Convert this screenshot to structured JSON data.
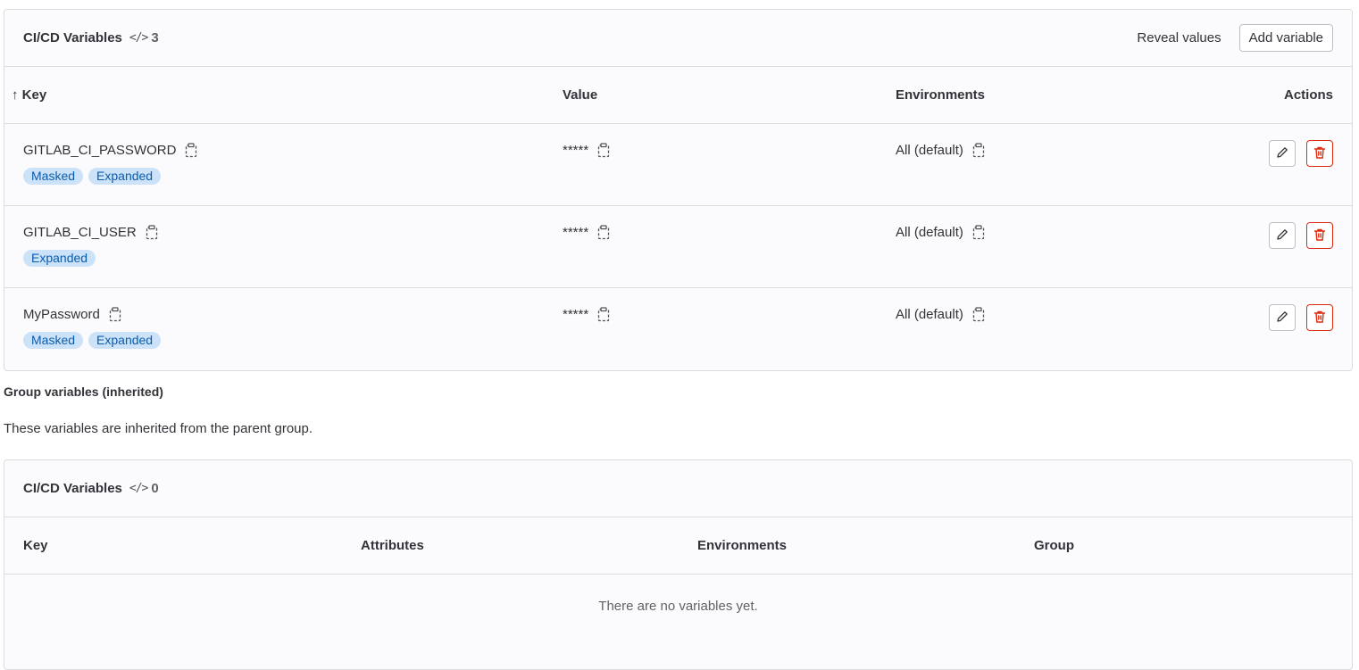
{
  "project_variables": {
    "title": "CI/CD Variables",
    "count": "3",
    "code_symbol": "</>",
    "reveal_label": "Reveal values",
    "add_label": "Add variable",
    "columns": {
      "key": "↑ Key",
      "value": "Value",
      "environments": "Environments",
      "actions": "Actions"
    },
    "rows": [
      {
        "key": "GITLAB_CI_PASSWORD",
        "value": "*****",
        "env": "All (default)",
        "badges": [
          "Masked",
          "Expanded"
        ]
      },
      {
        "key": "GITLAB_CI_USER",
        "value": "*****",
        "env": "All (default)",
        "badges": [
          "Expanded"
        ]
      },
      {
        "key": "MyPassword",
        "value": "*****",
        "env": "All (default)",
        "badges": [
          "Masked",
          "Expanded"
        ]
      }
    ]
  },
  "group_section": {
    "title": "Group variables (inherited)",
    "description": "These variables are inherited from the parent group."
  },
  "group_variables": {
    "title": "CI/CD Variables",
    "count": "0",
    "code_symbol": "</>",
    "columns": {
      "key": "Key",
      "attributes": "Attributes",
      "environments": "Environments",
      "group": "Group"
    },
    "empty_text": "There are no variables yet."
  },
  "colors": {
    "badge_bg": "#cbe2f9",
    "badge_text": "#0b5cad",
    "danger": "#dd2b0e"
  },
  "icons": {
    "copy": "copy-to-clipboard-icon",
    "edit": "pencil-icon",
    "delete": "trash-icon"
  }
}
